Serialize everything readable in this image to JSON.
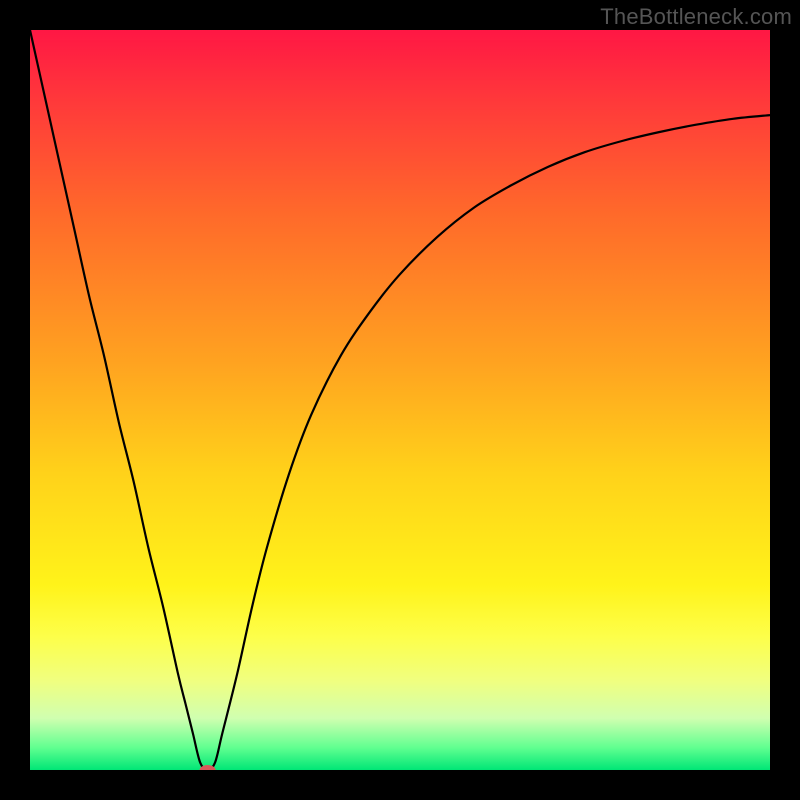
{
  "watermark": "TheBottleneck.com",
  "chart_data": {
    "type": "line",
    "title": "",
    "xlabel": "",
    "ylabel": "",
    "xlim": [
      0,
      100
    ],
    "ylim": [
      0,
      100
    ],
    "grid": false,
    "legend": false,
    "background_gradient": {
      "stops": [
        {
          "offset": 0.0,
          "color": "#ff1744"
        },
        {
          "offset": 0.1,
          "color": "#ff3a3a"
        },
        {
          "offset": 0.25,
          "color": "#ff6a2a"
        },
        {
          "offset": 0.45,
          "color": "#ffa320"
        },
        {
          "offset": 0.6,
          "color": "#ffd21a"
        },
        {
          "offset": 0.75,
          "color": "#fff31a"
        },
        {
          "offset": 0.82,
          "color": "#fdff4a"
        },
        {
          "offset": 0.88,
          "color": "#f0ff80"
        },
        {
          "offset": 0.93,
          "color": "#d0ffb0"
        },
        {
          "offset": 0.97,
          "color": "#60ff90"
        },
        {
          "offset": 1.0,
          "color": "#00e676"
        }
      ]
    },
    "series": [
      {
        "name": "curve",
        "color": "#000000",
        "x": [
          0,
          2,
          4,
          6,
          8,
          10,
          12,
          14,
          16,
          18,
          20,
          21,
          22,
          23,
          24,
          25,
          26,
          28,
          30,
          32,
          35,
          38,
          42,
          46,
          50,
          55,
          60,
          65,
          70,
          75,
          80,
          85,
          90,
          95,
          100
        ],
        "y": [
          100,
          91,
          82,
          73,
          64,
          56,
          47,
          39,
          30,
          22,
          13,
          9,
          5,
          1,
          0,
          1,
          5,
          13,
          22,
          30,
          40,
          48,
          56,
          62,
          67,
          72,
          76,
          79,
          81.5,
          83.5,
          85,
          86.2,
          87.2,
          88,
          88.5
        ]
      }
    ],
    "markers": [
      {
        "name": "min-marker",
        "x": 24,
        "y": 0,
        "color": "#d85a5a",
        "rx": 8,
        "ry": 5
      }
    ]
  }
}
